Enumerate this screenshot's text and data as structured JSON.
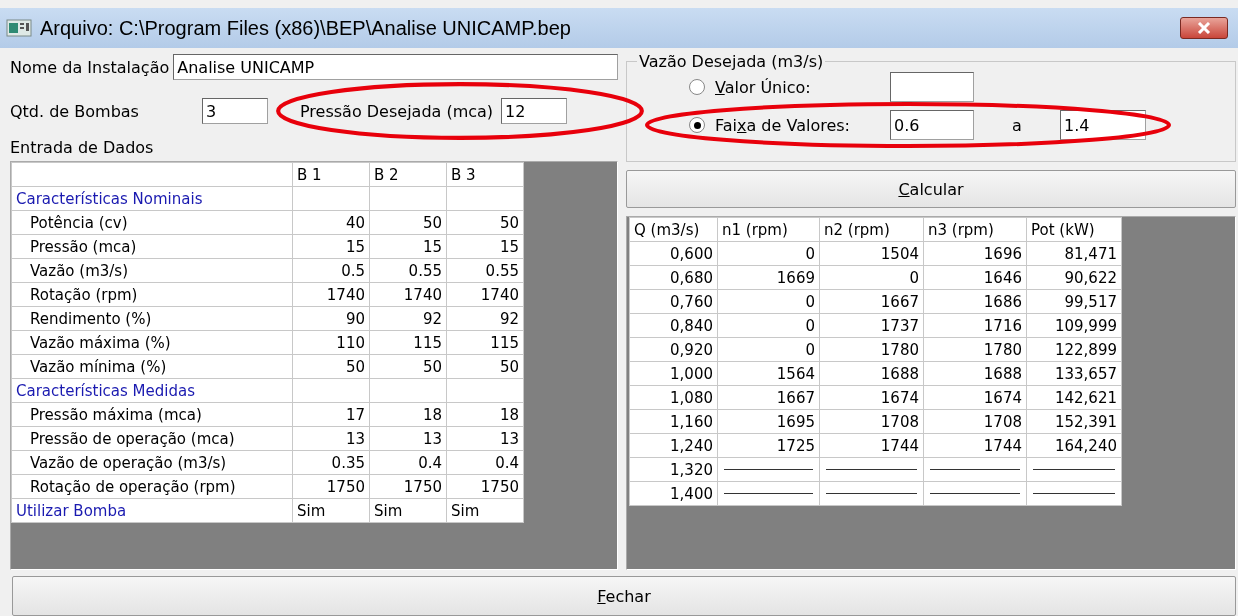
{
  "window": {
    "title": "Arquivo: C:\\Program Files (x86)\\BEP\\Analise UNICAMP.bep"
  },
  "installation": {
    "label": "Nome da Instalação",
    "value": "Analise UNICAMP"
  },
  "pumps": {
    "label": "Qtd. de Bombas",
    "value": "3"
  },
  "pressure": {
    "label": "Pressão Desejada (mca)",
    "value": "12",
    "highlighted": true
  },
  "input_data": {
    "title": "Entrada de Dados",
    "columns": [
      "B 1",
      "B 2",
      "B 3"
    ],
    "rows": [
      {
        "kind": "section",
        "label": "Características Nominais",
        "cells": []
      },
      {
        "kind": "param",
        "label": "Potência (cv)",
        "cells": [
          "40",
          "50",
          "50"
        ]
      },
      {
        "kind": "param",
        "label": "Pressão (mca)",
        "cells": [
          "15",
          "15",
          "15"
        ]
      },
      {
        "kind": "param",
        "label": "Vazão (m3/s)",
        "cells": [
          "0.5",
          "0.55",
          "0.55"
        ]
      },
      {
        "kind": "param",
        "label": "Rotação (rpm)",
        "cells": [
          "1740",
          "1740",
          "1740"
        ]
      },
      {
        "kind": "param",
        "label": "Rendimento (%)",
        "cells": [
          "90",
          "92",
          "92"
        ]
      },
      {
        "kind": "param",
        "label": "Vazão máxima (%)",
        "cells": [
          "110",
          "115",
          "115"
        ]
      },
      {
        "kind": "param",
        "label": "Vazão mínima (%)",
        "cells": [
          "50",
          "50",
          "50"
        ]
      },
      {
        "kind": "section",
        "label": "Características Medidas",
        "cells": []
      },
      {
        "kind": "param",
        "label": "Pressão máxima (mca)",
        "cells": [
          "17",
          "18",
          "18"
        ]
      },
      {
        "kind": "param",
        "label": "Pressão de operação (mca)",
        "cells": [
          "13",
          "13",
          "13"
        ]
      },
      {
        "kind": "param",
        "label": "Vazão de operação (m3/s)",
        "cells": [
          "0.35",
          "0.4",
          "0.4"
        ]
      },
      {
        "kind": "param",
        "label": "Rotação de operação (rpm)",
        "cells": [
          "1750",
          "1750",
          "1750"
        ]
      },
      {
        "kind": "option",
        "label": "Utilizar Bomba",
        "cells": [
          "Sim",
          "Sim",
          "Sim"
        ]
      }
    ]
  },
  "flow": {
    "title": "Vazão Desejada (m3/s)",
    "single": {
      "label": {
        "access_key": "V",
        "after": "alor Único:"
      },
      "selected": false
    },
    "range": {
      "label": {
        "before": "Fai",
        "access_key": "x",
        "after": "a de Valores:"
      },
      "selected": true,
      "from": "0.6",
      "separator": "a",
      "to": "1.4",
      "highlighted": true
    }
  },
  "calculate_button": {
    "label": {
      "access_key": "C",
      "after": "alcular"
    }
  },
  "results": {
    "columns": [
      "Q (m3/s)",
      "n1 (rpm)",
      "n2 (rpm)",
      "n3 (rpm)",
      "Pot (kW)"
    ],
    "rows": [
      {
        "kind": "result",
        "cells": [
          "0,600",
          "0",
          "1504",
          "1696",
          "81,471"
        ]
      },
      {
        "kind": "result",
        "cells": [
          "0,680",
          "1669",
          "0",
          "1646",
          "90,622"
        ]
      },
      {
        "kind": "result",
        "cells": [
          "0,760",
          "0",
          "1667",
          "1686",
          "99,517"
        ]
      },
      {
        "kind": "result",
        "cells": [
          "0,840",
          "0",
          "1737",
          "1716",
          "109,999"
        ]
      },
      {
        "kind": "result",
        "cells": [
          "0,920",
          "0",
          "1780",
          "1780",
          "122,899"
        ]
      },
      {
        "kind": "result",
        "cells": [
          "1,000",
          "1564",
          "1688",
          "1688",
          "133,657"
        ]
      },
      {
        "kind": "result",
        "cells": [
          "1,080",
          "1667",
          "1674",
          "1674",
          "142,621"
        ]
      },
      {
        "kind": "result",
        "cells": [
          "1,160",
          "1695",
          "1708",
          "1708",
          "152,391"
        ]
      },
      {
        "kind": "result",
        "cells": [
          "1,240",
          "1725",
          "1744",
          "1744",
          "164,240"
        ]
      },
      {
        "kind": "no_result",
        "cells": [
          "1,320"
        ]
      },
      {
        "kind": "no_result",
        "cells": [
          "1,400"
        ]
      }
    ]
  },
  "close_button": {
    "label": {
      "access_key": "F",
      "after": "echar"
    }
  }
}
